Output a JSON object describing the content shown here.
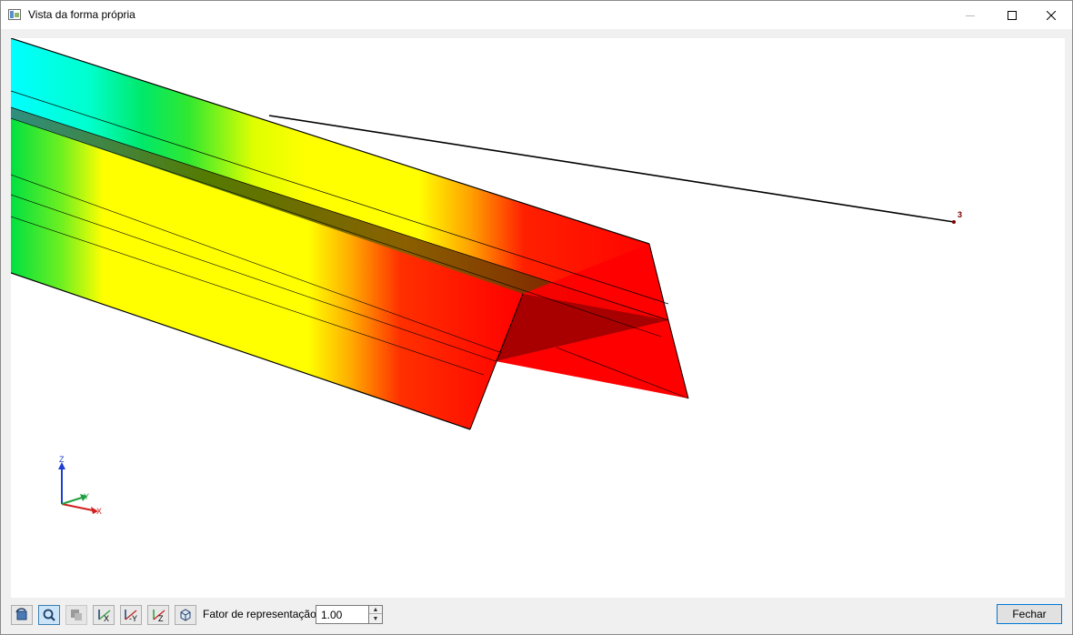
{
  "window": {
    "title": "Vista da forma própria"
  },
  "viewport": {
    "node_label": "3",
    "axes": {
      "z": "Z",
      "y": "Y",
      "x": "X"
    },
    "colors": {
      "cyan": "#00ffff",
      "green": "#00e040",
      "yellow": "#ffff00",
      "orange": "#ff8c00",
      "red": "#ff0000",
      "shadow": "#7a0000"
    }
  },
  "toolbar": {
    "buttons": [
      {
        "name": "view-rotate-icon",
        "state": "normal"
      },
      {
        "name": "zoom-icon",
        "state": "active"
      },
      {
        "name": "render-mode-icon",
        "state": "disabled"
      },
      {
        "name": "view-x-icon",
        "label": "X",
        "state": "normal"
      },
      {
        "name": "view-minus-y-icon",
        "label": "-Y",
        "state": "normal"
      },
      {
        "name": "view-z-icon",
        "label": "Z",
        "state": "normal"
      },
      {
        "name": "view-iso-icon",
        "state": "normal"
      }
    ],
    "factor_label": "Fator de representação:",
    "factor_value": "1.00",
    "close_label": "Fechar"
  }
}
